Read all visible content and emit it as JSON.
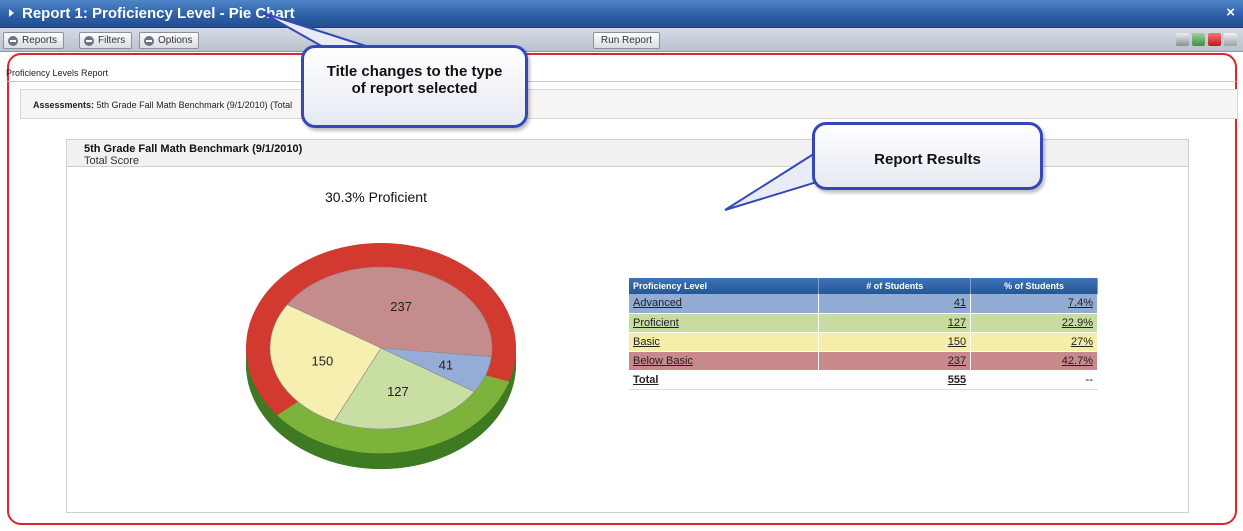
{
  "window": {
    "title": "Report 1: Proficiency Level - Pie Chart",
    "close_glyph": "×"
  },
  "toolbar": {
    "reports_label": "Reports",
    "filters_label": "Filters",
    "options_label": "Options",
    "run_label": "Run Report",
    "icons": [
      "print-icon",
      "export-icon",
      "pdf-icon",
      "printer-icon"
    ]
  },
  "report": {
    "label": "Proficiency Levels Report",
    "assessments_label": "Assessments:",
    "assessments_value": "5th Grade Fall Math Benchmark (9/1/2010) (Total"
  },
  "panel": {
    "title": "5th Grade Fall Math Benchmark (9/1/2010)",
    "subtitle": "Total Score",
    "proficient_text": "30.3% Proficient"
  },
  "chart_data": {
    "type": "pie",
    "title": "30.3% Proficient",
    "slices": [
      {
        "label": "Advanced",
        "value": 41,
        "color": "#95add6"
      },
      {
        "label": "Proficient",
        "value": 127,
        "color": "#c9dea3"
      },
      {
        "label": "Basic",
        "value": 150,
        "color": "#f7efb0"
      },
      {
        "label": "Below Basic",
        "value": 237,
        "color": "#c58c8e"
      }
    ],
    "style": "3d"
  },
  "table": {
    "headers": [
      "Proficiency Level",
      "# of Students",
      "% of Students"
    ],
    "rows": [
      {
        "level": "Advanced",
        "students": "41",
        "percent": "7.4%"
      },
      {
        "level": "Proficient",
        "students": "127",
        "percent": "22.9%"
      },
      {
        "level": "Basic",
        "students": "150",
        "percent": "27%"
      },
      {
        "level": "Below Basic",
        "students": "237",
        "percent": "42.7%"
      }
    ],
    "total": {
      "label": "Total",
      "students": "555",
      "percent": "--"
    }
  },
  "callouts": {
    "title_note": "Title changes to the type of report selected",
    "results_note": "Report Results"
  },
  "colors": {
    "accent": "#2b5ea6",
    "frame": "#d8262c",
    "callout_border": "#3548b8",
    "rim_red": "#d33a2f",
    "rim_green": "#7eb33b"
  }
}
